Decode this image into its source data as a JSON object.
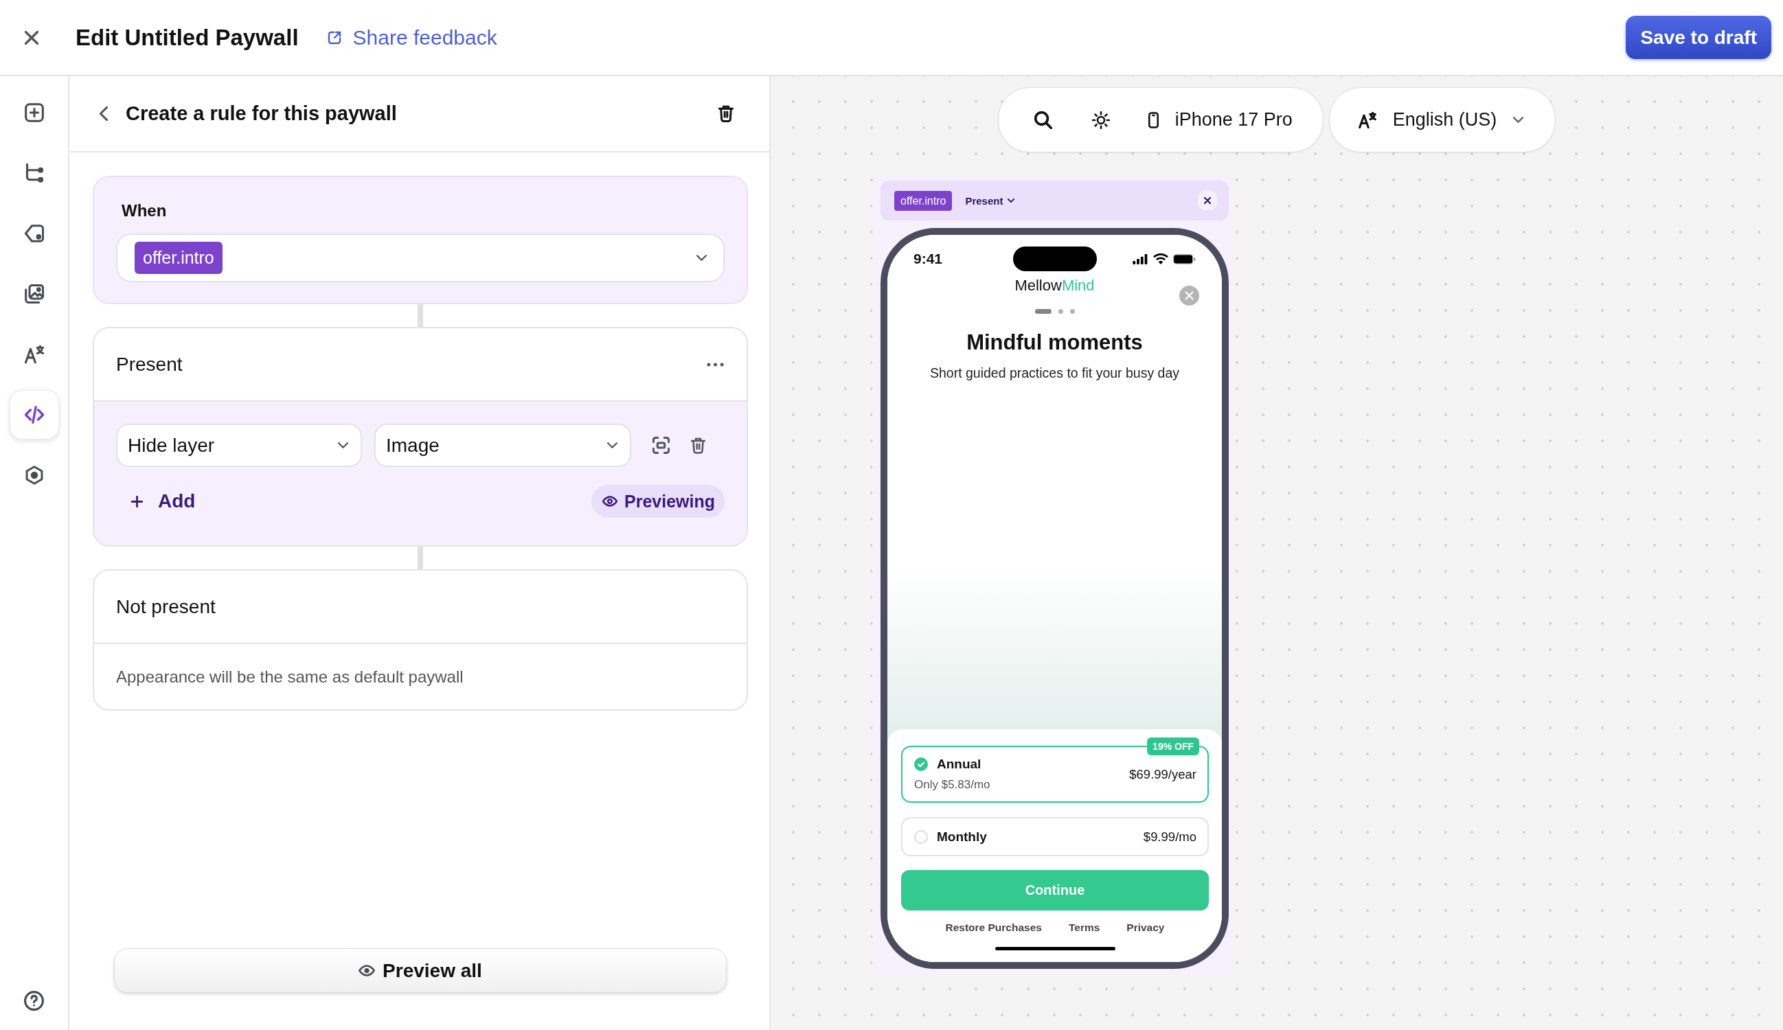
{
  "header": {
    "title": "Edit Untitled Paywall",
    "feedback_link": "Share feedback",
    "save_button": "Save to draft"
  },
  "sidebar": {
    "items": [
      {
        "selected": false
      },
      {
        "selected": false
      },
      {
        "selected": false
      },
      {
        "selected": false
      },
      {
        "selected": false
      },
      {
        "selected": true
      },
      {
        "selected": false
      }
    ]
  },
  "rule_panel": {
    "title": "Create a rule for this paywall",
    "when": {
      "label": "When",
      "condition": "offer.intro"
    },
    "present": {
      "title": "Present",
      "rules": [
        {
          "action": "Hide layer",
          "target": "Image"
        }
      ],
      "add_label": "Add",
      "previewing_label": "Previewing"
    },
    "not_present": {
      "title": "Not present",
      "description": "Appearance will be the same as default paywall"
    },
    "preview_all_button": "Preview all"
  },
  "preview_toolbar": {
    "device": "iPhone 17 Pro",
    "language": "English (US)"
  },
  "preview": {
    "condition": "offer.intro",
    "state": "Present",
    "phone": {
      "time": "9:41",
      "logo": {
        "text": "Mellow",
        "accent": "Mind"
      },
      "page_dots": [
        {
          "selected": true
        },
        {
          "selected": false
        },
        {
          "selected": false
        }
      ],
      "headline": "Mindful moments",
      "subtitle": "Short guided practices to fit your busy day",
      "plans": [
        {
          "name": "Annual",
          "note": "Only $5.83/mo",
          "price": "$69.99/year",
          "badge": "19% OFF",
          "selected": true
        },
        {
          "name": "Monthly",
          "price": "$9.99/mo",
          "selected": false
        }
      ],
      "cta": "Continue",
      "footer_links": [
        "Restore Purchases",
        "Terms",
        "Privacy"
      ]
    }
  }
}
